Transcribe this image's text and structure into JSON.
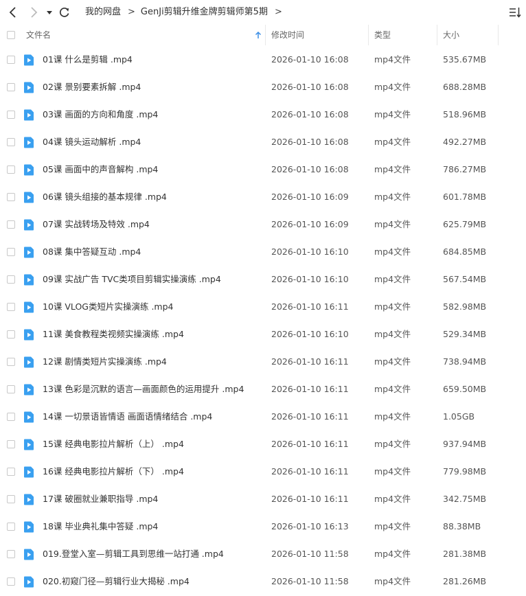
{
  "breadcrumb": {
    "items": [
      "我的网盘",
      "GenJi剪辑升维金牌剪辑师第5期"
    ]
  },
  "columns": {
    "name": "文件名",
    "modified": "修改时间",
    "type": "类型",
    "size": "大小"
  },
  "colors": {
    "file_icon": "#3aa0f0",
    "arrow_accent": "#3a8ee6"
  },
  "icons": {
    "back": "chevron-left-icon",
    "forward": "chevron-right-icon",
    "dropdown": "caret-down-icon",
    "refresh": "refresh-icon",
    "sort": "sort-list-icon",
    "file": "video-file-icon"
  },
  "files": [
    {
      "name": "01课 什么是剪辑 .mp4",
      "modified": "2026-01-10 16:08",
      "type": "mp4文件",
      "size": "535.67MB"
    },
    {
      "name": "02课 景别要素拆解 .mp4",
      "modified": "2026-01-10 16:08",
      "type": "mp4文件",
      "size": "688.28MB"
    },
    {
      "name": "03课 画面的方向和角度 .mp4",
      "modified": "2026-01-10 16:08",
      "type": "mp4文件",
      "size": "518.96MB"
    },
    {
      "name": "04课 镜头运动解析 .mp4",
      "modified": "2026-01-10 16:08",
      "type": "mp4文件",
      "size": "492.27MB"
    },
    {
      "name": "05课 画面中的声音解构 .mp4",
      "modified": "2026-01-10 16:08",
      "type": "mp4文件",
      "size": "786.27MB"
    },
    {
      "name": "06课 镜头组接的基本规律 .mp4",
      "modified": "2026-01-10 16:09",
      "type": "mp4文件",
      "size": "601.78MB"
    },
    {
      "name": "07课 实战转场及特效 .mp4",
      "modified": "2026-01-10 16:09",
      "type": "mp4文件",
      "size": "625.79MB"
    },
    {
      "name": "08课 集中答疑互动 .mp4",
      "modified": "2026-01-10 16:10",
      "type": "mp4文件",
      "size": "684.85MB"
    },
    {
      "name": "09课 实战广告 TVC类项目剪辑实操演练 .mp4",
      "modified": "2026-01-10 16:10",
      "type": "mp4文件",
      "size": "567.54MB"
    },
    {
      "name": "10课 VLOG类短片实操演练 .mp4",
      "modified": "2026-01-10 16:11",
      "type": "mp4文件",
      "size": "582.98MB"
    },
    {
      "name": "11课 美食教程类视频实操演练 .mp4",
      "modified": "2026-01-10 16:10",
      "type": "mp4文件",
      "size": "529.34MB"
    },
    {
      "name": "12课 剧情类短片实操演练 .mp4",
      "modified": "2026-01-10 16:11",
      "type": "mp4文件",
      "size": "738.94MB"
    },
    {
      "name": "13课 色彩是沉默的语言—画面颜色的运用提升 .mp4",
      "modified": "2026-01-10 16:11",
      "type": "mp4文件",
      "size": "659.50MB"
    },
    {
      "name": "14课 一切景语皆情语 画面语情绪结合 .mp4",
      "modified": "2026-01-10 16:11",
      "type": "mp4文件",
      "size": "1.05GB"
    },
    {
      "name": "15课 经典电影拉片解析（上） .mp4",
      "modified": "2026-01-10 16:11",
      "type": "mp4文件",
      "size": "937.94MB"
    },
    {
      "name": "16课 经典电影拉片解析（下） .mp4",
      "modified": "2026-01-10 16:11",
      "type": "mp4文件",
      "size": "779.98MB"
    },
    {
      "name": "17课 破圈就业兼职指导 .mp4",
      "modified": "2026-01-10 16:11",
      "type": "mp4文件",
      "size": "342.75MB"
    },
    {
      "name": "18课 毕业典礼集中答疑 .mp4",
      "modified": "2026-01-10 16:13",
      "type": "mp4文件",
      "size": "88.38MB"
    },
    {
      "name": "019.登堂入室—剪辑工具到思维一站打通 .mp4",
      "modified": "2026-01-10 11:58",
      "type": "mp4文件",
      "size": "281.38MB"
    },
    {
      "name": "020.初窥门径—剪辑行业大揭秘 .mp4",
      "modified": "2026-01-10 11:58",
      "type": "mp4文件",
      "size": "281.26MB"
    }
  ]
}
